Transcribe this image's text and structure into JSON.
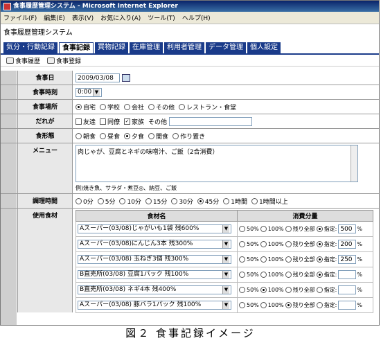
{
  "window": {
    "title": "食事履歴管理システム - Microsoft Internet Explorer"
  },
  "menu": [
    "ファイル(F)",
    "編集(E)",
    "表示(V)",
    "お気に入り(A)",
    "ツール(T)",
    "ヘルプ(H)"
  ],
  "app_title": "食事履歴管理システム",
  "tabs": [
    "気分・行動記録",
    "食事記録",
    "買物記録",
    "在庫管理",
    "利用者管理",
    "データ管理",
    "個人設定"
  ],
  "subnav": [
    "食事履歴",
    "食事登録"
  ],
  "form": {
    "date": {
      "label": "食事日",
      "value": "2009/03/08"
    },
    "time": {
      "label": "食事時刻",
      "value": "0:00"
    },
    "place": {
      "label": "食事場所",
      "options": [
        "自宅",
        "学校",
        "会社",
        "その他",
        "レストラン・食堂"
      ],
      "selected": 0
    },
    "who": {
      "label": "だれが",
      "options": [
        "友達",
        "同僚",
        "家族"
      ],
      "checked": [
        false,
        false,
        true
      ],
      "other_label": "その他",
      "other_value": ""
    },
    "type": {
      "label": "食形態",
      "options": [
        "朝食",
        "昼食",
        "夕食",
        "間食",
        "作り置き"
      ],
      "selected": 2
    },
    "menu": {
      "label": "メニュー",
      "value": "肉じゃが、豆腐とネギの味噌汁、ご飯（2合消費）",
      "hint": "例)焼き魚、サラダ・煮豆◎、納豆、ご飯"
    },
    "cooktime": {
      "label": "調理時間",
      "options": [
        "0分",
        "5分",
        "10分",
        "15分",
        "30分",
        "45分",
        "1時間",
        "1時間以上"
      ],
      "selected": 5
    },
    "ingredients": {
      "label": "使用食材",
      "headers": [
        "食材名",
        "消費分量"
      ],
      "options": [
        "50%",
        "100%",
        "残り全部",
        "指定:"
      ],
      "unit": "%",
      "rows": [
        {
          "name": "Aスーパー(03/08)じゃがいも1袋 残600%",
          "selected": 3,
          "amount": "500"
        },
        {
          "name": "Aスーパー(03/08)にんじん3本 残300%",
          "selected": 3,
          "amount": "200"
        },
        {
          "name": "Aスーパー(03/08) 玉ねぎ3個 残300%",
          "selected": 3,
          "amount": "250"
        },
        {
          "name": "B直売所(03/08) 豆腐1パック 残100%",
          "selected": 3,
          "amount": ""
        },
        {
          "name": "B直売所(03/08) ネギ4本 残400%",
          "selected": 1,
          "amount": ""
        },
        {
          "name": "Aスーパー(03/08) 豚バラ1パック 残100%",
          "selected": 2,
          "amount": ""
        }
      ]
    }
  },
  "caption": "図２ 食事記録イメージ"
}
